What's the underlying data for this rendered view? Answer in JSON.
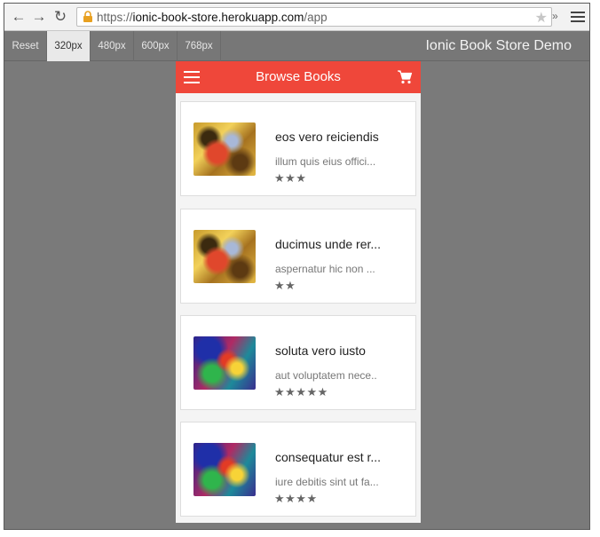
{
  "browser": {
    "url_prefix": "https://",
    "url_host": "ionic-book-store.herokuapp.com",
    "url_path": "/app",
    "extensions_label": "»"
  },
  "toolbar": {
    "buttons": [
      "Reset",
      "320px",
      "480px",
      "600px",
      "768px"
    ],
    "active": "320px",
    "title": "Ionic Book Store Demo"
  },
  "app": {
    "header_title": "Browse Books",
    "accent_color": "#ef473a"
  },
  "books": [
    {
      "title": "eos vero reiciendis",
      "subtitle": "illum quis eius offici...",
      "stars": "★★★",
      "rating": 3,
      "image": "gold"
    },
    {
      "title": "ducimus unde rer...",
      "subtitle": "aspernatur hic non ...",
      "stars": "★★",
      "rating": 2,
      "image": "gold"
    },
    {
      "title": "soluta vero iusto",
      "subtitle": "aut voluptatem nece..",
      "stars": "★★★★★",
      "rating": 5,
      "image": "colorful"
    },
    {
      "title": "consequatur est r...",
      "subtitle": "iure debitis sint ut fa...",
      "stars": "★★★★",
      "rating": 4,
      "image": "colorful"
    }
  ]
}
